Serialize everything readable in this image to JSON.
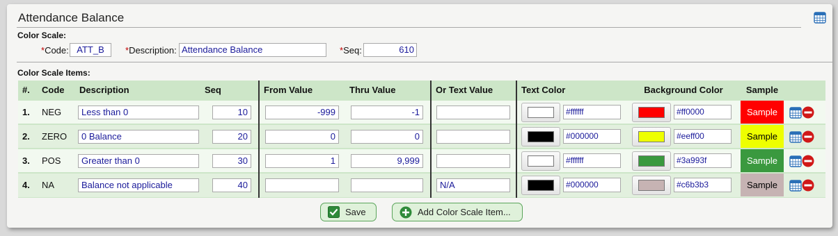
{
  "panel": {
    "title": "Attendance Balance"
  },
  "color_scale": {
    "section_label": "Color Scale:",
    "code_label": "Code:",
    "code_value": "ATT_B",
    "description_label": "Description:",
    "description_value": "Attendance Balance",
    "seq_label": "Seq:",
    "seq_value": "610",
    "required_mark": "*"
  },
  "items": {
    "section_label": "Color Scale Items:",
    "columns": {
      "num": "#.",
      "code": "Code",
      "description": "Description",
      "seq": "Seq",
      "from_value": "From Value",
      "thru_value": "Thru Value",
      "or_text_value": "Or Text Value",
      "text_color": "Text Color",
      "background_color": "Background Color",
      "sample": "Sample"
    },
    "rows": [
      {
        "num": "1.",
        "code": "NEG",
        "description": "Less than 0",
        "seq": "10",
        "from": "-999",
        "thru": "-1",
        "text": "",
        "text_color": "#ffffff",
        "bg_color": "#ff0000",
        "sample": "Sample"
      },
      {
        "num": "2.",
        "code": "ZERO",
        "description": "0 Balance",
        "seq": "20",
        "from": "0",
        "thru": "0",
        "text": "",
        "text_color": "#000000",
        "bg_color": "#eeff00",
        "sample": "Sample"
      },
      {
        "num": "3.",
        "code": "POS",
        "description": "Greater than 0",
        "seq": "30",
        "from": "1",
        "thru": "9,999",
        "text": "",
        "text_color": "#ffffff",
        "bg_color": "#3a993f",
        "sample": "Sample"
      },
      {
        "num": "4.",
        "code": "NA",
        "description": "Balance not applicable",
        "seq": "40",
        "from": "",
        "thru": "",
        "text": "N/A",
        "text_color": "#000000",
        "bg_color": "#c6b3b3",
        "sample": "Sample"
      }
    ],
    "row_icons": [
      "calendar-icon",
      "remove-icon"
    ]
  },
  "footer": {
    "save_label": "Save",
    "add_label": "Add Color Scale Item..."
  },
  "colors": {
    "header_green": "#cde6c8",
    "row_light": "#f2f9f0",
    "row_dark": "#e2f0de",
    "input_text": "#1a1a9a",
    "required": "#c00000",
    "button_border": "#5aa45a",
    "remove_red": "#d01818"
  }
}
